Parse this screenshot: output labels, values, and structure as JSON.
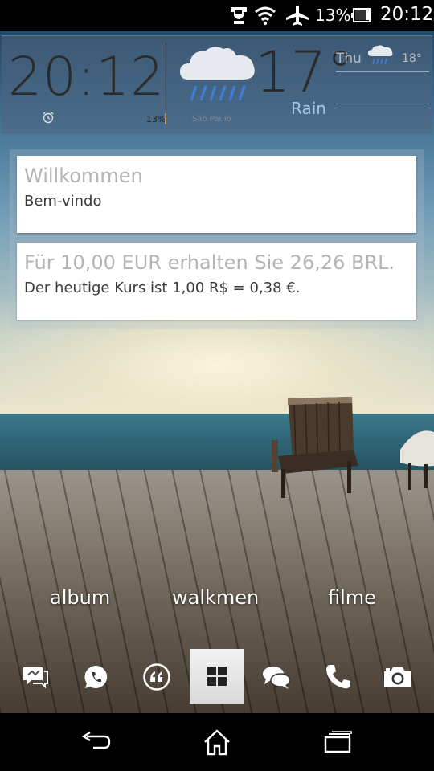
{
  "status_bar": {
    "battery_percent": "13%",
    "time": "20:12",
    "icons": [
      "usb-debug-icon",
      "wifi-icon",
      "airplane-mode-icon",
      "battery-icon"
    ]
  },
  "clock_widget": {
    "time": "20:12",
    "battery": "13%",
    "city": "São Paulo",
    "temperature": "17°",
    "condition": "Rain",
    "forecast": {
      "day": "Thu",
      "temperature": "18°",
      "icon": "rain-cloud-icon"
    }
  },
  "cards": [
    {
      "title": "Willkommen",
      "subtitle": "Bem-vindo"
    },
    {
      "title": "Für 10,00 EUR erhalten Sie 26,26 BRL.",
      "subtitle": "Der heutige Kurs ist 1,00 R$ = 0,38 €."
    }
  ],
  "shortcuts": [
    "album",
    "walkmen",
    "filme"
  ],
  "dock": [
    "messaging-icon",
    "whatsapp-icon",
    "quotes-icon",
    "apps-grid-icon",
    "chat-icon",
    "phone-icon",
    "camera-icon"
  ],
  "nav": [
    "back-icon",
    "home-icon",
    "recents-icon"
  ],
  "colors": {
    "condition_text": "#a9c8e4",
    "battery_bar": "#e08a2a",
    "card_bg": "#ffffff"
  }
}
